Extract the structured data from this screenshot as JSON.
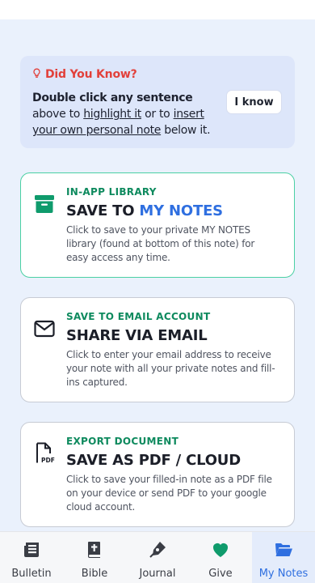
{
  "tip": {
    "title": "Did You Know?",
    "bold_lead": "Double click any sentence",
    "text_1": " above to ",
    "link_1": "highlight it",
    "text_2": " or to ",
    "link_2": "insert your own personal note",
    "text_3": " below it.",
    "button": "I know"
  },
  "cards": [
    {
      "icon": "archive-icon",
      "kicker": "IN-APP LIBRARY",
      "heading_prefix": "SAVE TO ",
      "heading_highlight": "MY NOTES",
      "description": "Click to save to your private MY NOTES library (found at bottom of this note) for easy access any time."
    },
    {
      "icon": "envelope-icon",
      "kicker": "SAVE TO EMAIL ACCOUNT",
      "heading": "SHARE VIA EMAIL",
      "description": "Click to enter your email address to receive your note with all your private notes and fill-ins captured."
    },
    {
      "icon": "pdf-file-icon",
      "kicker": "EXPORT DOCUMENT",
      "heading": "SAVE AS PDF / CLOUD",
      "description": "Click to save your filled-in note as a PDF file on your device or send PDF to your google cloud account."
    }
  ],
  "nav": [
    {
      "label": "Bulletin",
      "icon": "newspaper-icon"
    },
    {
      "label": "Bible",
      "icon": "bible-icon"
    },
    {
      "label": "Journal",
      "icon": "pen-icon"
    },
    {
      "label": "Give",
      "icon": "heart-icon"
    },
    {
      "label": "My Notes",
      "icon": "folder-open-icon",
      "active": true
    }
  ],
  "colors": {
    "background": "#eaf1fc",
    "tip_bg": "#dde6fa",
    "tip_title": "#e2403a",
    "kicker_green": "#0e8a5e",
    "accent_blue": "#2f6fe0",
    "active_border": "#4bd0a4",
    "heart_green": "#0f9b6c"
  }
}
